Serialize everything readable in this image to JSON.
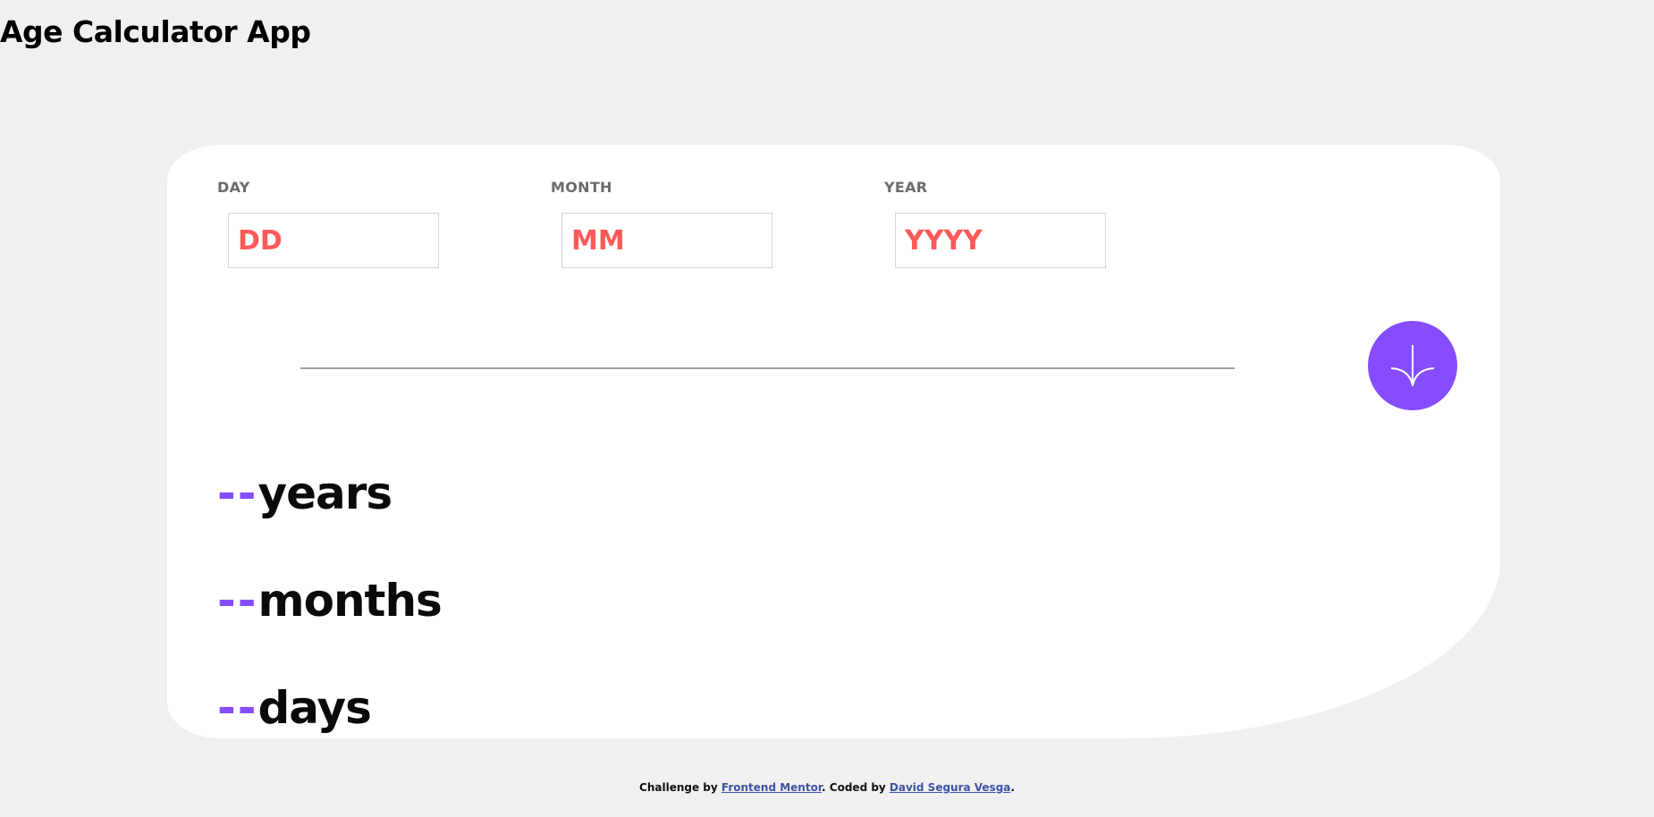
{
  "app": {
    "title": "Age Calculator App"
  },
  "form": {
    "day": {
      "label": "DAY",
      "placeholder": "DD",
      "value": ""
    },
    "month": {
      "label": "MONTH",
      "placeholder": "MM",
      "value": ""
    },
    "year": {
      "label": "YEAR",
      "placeholder": "YYYY",
      "value": ""
    },
    "submit_icon": "arrow-down-icon"
  },
  "results": {
    "years": {
      "value": "--",
      "unit": "years"
    },
    "months": {
      "value": "--",
      "unit": "months"
    },
    "days": {
      "value": "--",
      "unit": "days"
    }
  },
  "footer": {
    "prefix": "Challenge by ",
    "challenge_link": "Frontend Mentor",
    "middle": ". Coded by ",
    "author_link": "David Segura Vesga",
    "suffix": "."
  },
  "colors": {
    "accent": "#854dff",
    "error": "#ff5959",
    "background": "#f0f0f0",
    "card": "#ffffff"
  }
}
